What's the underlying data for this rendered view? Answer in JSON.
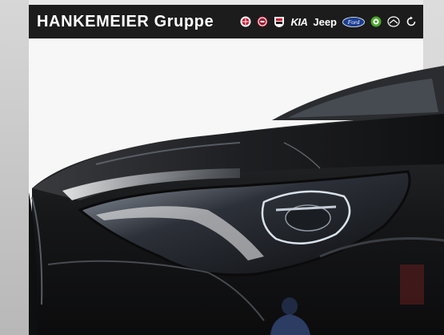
{
  "header": {
    "title": "HANKEMEIER Gruppe",
    "brands": [
      {
        "name": "alfa-romeo",
        "icon": "alfa-romeo-logo-icon"
      },
      {
        "name": "fiat",
        "icon": "fiat-logo-icon"
      },
      {
        "name": "abarth",
        "icon": "abarth-logo-icon"
      },
      {
        "name": "kia",
        "label": "KIA"
      },
      {
        "name": "jeep",
        "label": "Jeep"
      },
      {
        "name": "ford",
        "label": "Ford"
      },
      {
        "name": "skoda",
        "icon": "skoda-logo-icon"
      },
      {
        "name": "mazda",
        "icon": "mazda-logo-icon"
      },
      {
        "name": "other",
        "icon": "refresh-logo-icon"
      }
    ]
  },
  "colors": {
    "banner": "#1c1c1c",
    "banner_text": "#ffffff",
    "car_body": "#1a1b1d",
    "ford_blue": "#1c3f94",
    "skoda_green": "#4ba82e"
  }
}
